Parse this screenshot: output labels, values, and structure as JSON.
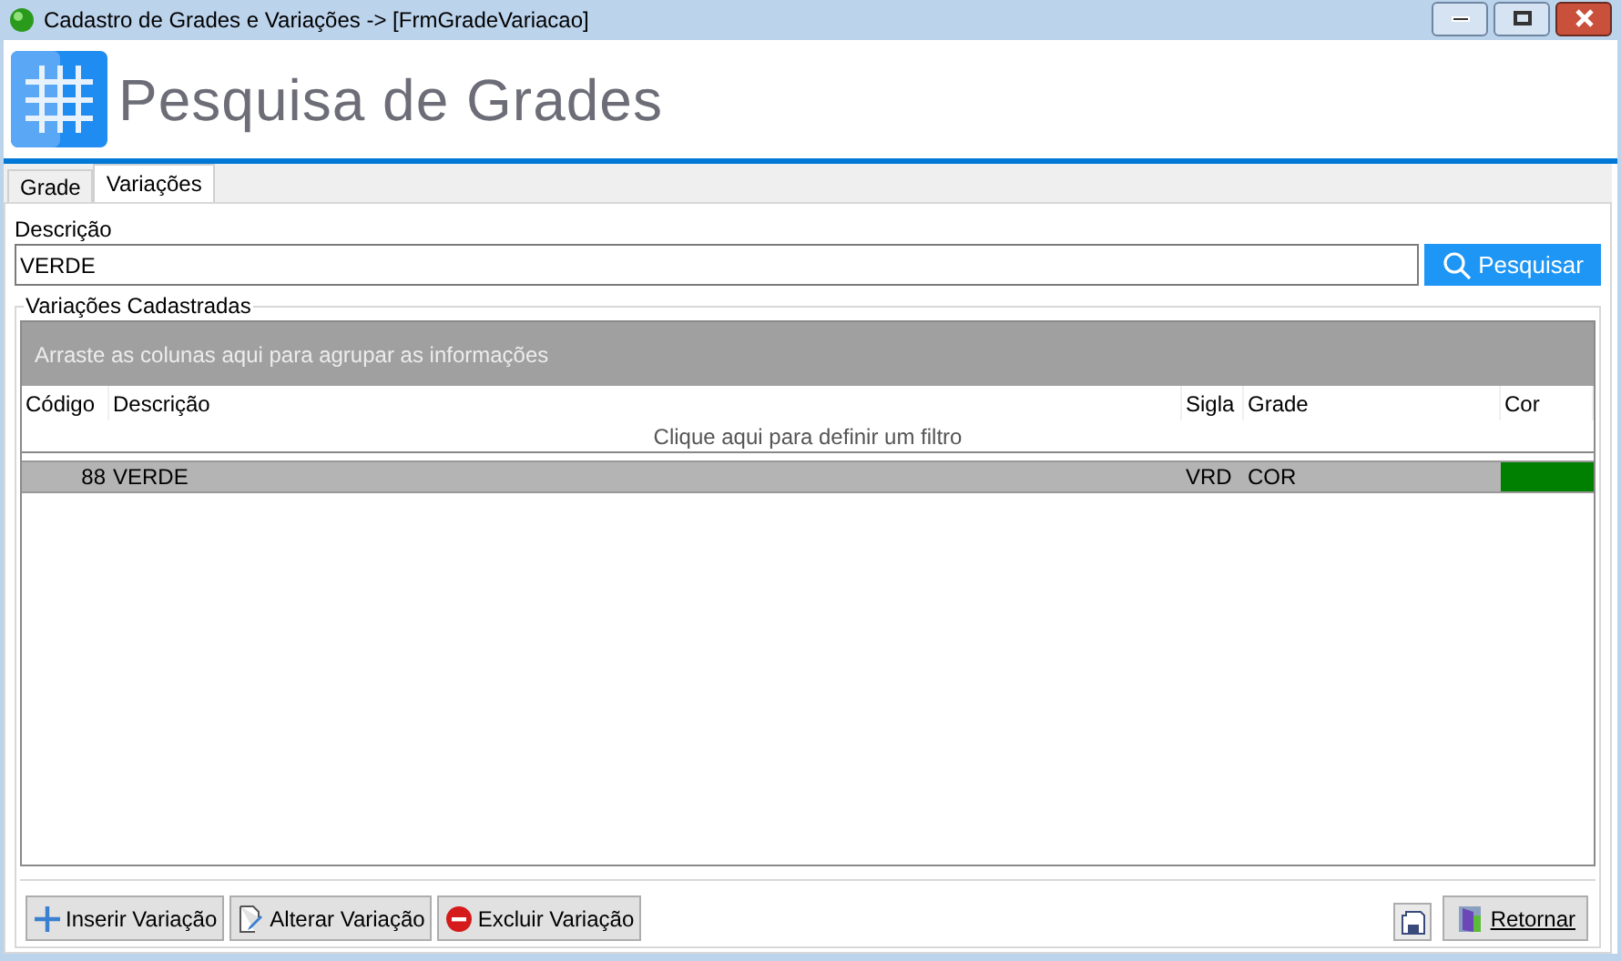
{
  "window": {
    "title": "Cadastro de Grades e Variações -> [FrmGradeVariacao]"
  },
  "header": {
    "title": "Pesquisa de Grades"
  },
  "tabs": [
    {
      "label": "Grade",
      "selected": false
    },
    {
      "label": "Variações",
      "selected": true
    }
  ],
  "search": {
    "label": "Descrição",
    "value": "VERDE",
    "button": "Pesquisar"
  },
  "group": {
    "title": "Variações Cadastradas",
    "group_panel": "Arraste as colunas aqui para agrupar as informações",
    "filter_hint": "Clique aqui para definir um filtro"
  },
  "table": {
    "columns": [
      "Código",
      "Descrição",
      "Sigla",
      "Grade",
      "Cor"
    ],
    "rows": [
      {
        "codigo": "88",
        "descricao": "VERDE",
        "sigla": "VRD",
        "grade": "COR",
        "color": "#008000",
        "selected": true
      }
    ]
  },
  "buttons": [
    {
      "label": "Inserir Variação",
      "kind": "insert"
    },
    {
      "label": "Alterar Variação",
      "kind": "edit"
    },
    {
      "label": "Excluir Variação",
      "kind": "delete"
    }
  ],
  "return_button": "Retornar"
}
